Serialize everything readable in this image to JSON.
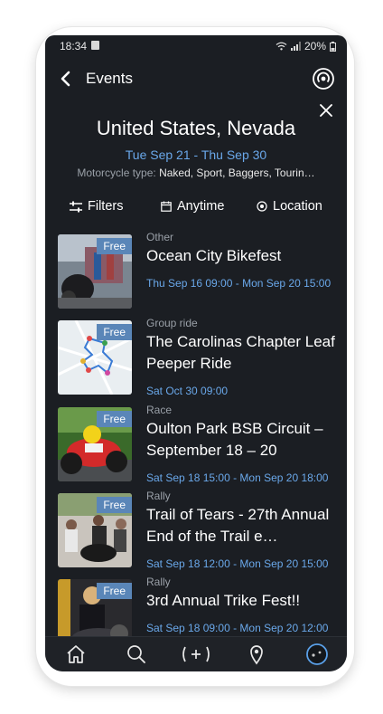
{
  "status": {
    "time": "18:34",
    "battery": "20%"
  },
  "appbar": {
    "title": "Events"
  },
  "header": {
    "country": "United States, Nevada",
    "dates": "Tue Sep 21 - Thu Sep 30",
    "types_label": "Motorcycle type:",
    "types_value": "Naked, Sport, Baggers, Tourin…"
  },
  "filters": {
    "filters_label": "Filters",
    "time_label": "Anytime",
    "location_label": "Location"
  },
  "events": [
    {
      "badge": "Free",
      "category": "Other",
      "title": "Ocean City Bikefest",
      "when": "Thu Sep 16 09:00 - Mon Sep 20 15:00"
    },
    {
      "badge": "Free",
      "category": "Group ride",
      "title": "The Carolinas Chapter Leaf Peeper Ride",
      "when": "Sat Oct 30 09:00"
    },
    {
      "badge": "Free",
      "category": "Race",
      "title": "Oulton Park BSB Circuit – September 18 – 20",
      "when": "Sat Sep 18 15:00 - Mon Sep 20 18:00"
    },
    {
      "badge": "Free",
      "category": "Rally",
      "title": "Trail of Tears - 27th Annual End of the Trail e…",
      "when": "Sat Sep 18 12:00 - Mon Sep 20 15:00"
    },
    {
      "badge": "Free",
      "category": "Rally",
      "title": "3rd Annual Trike Fest!!",
      "when": "Sat Sep 18 09:00 - Mon Sep 20 12:00"
    }
  ],
  "icons": {
    "back": "chevron-left-icon",
    "podcast": "broadcast-icon",
    "close": "close-icon",
    "filters": "sliders-icon",
    "calendar": "calendar-icon",
    "location": "location-target-icon",
    "nav": [
      "home-icon",
      "search-icon",
      "add-icon",
      "map-pin-icon",
      "profile-icon"
    ]
  },
  "colors": {
    "background": "#1b1e23",
    "accent": "#6aa8ea",
    "badge": "#5a86b8"
  }
}
